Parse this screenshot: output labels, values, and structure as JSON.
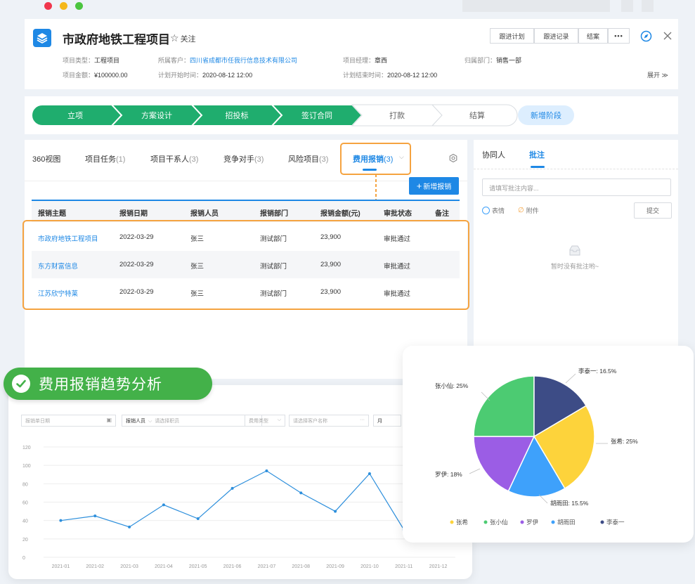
{
  "project": {
    "title": "市政府地铁工程项目",
    "follow": "关注",
    "buttons": [
      "跟进计划",
      "跟进记录",
      "结案"
    ],
    "more": "•••",
    "expand": "展开",
    "meta": {
      "type_label": "项目类型：",
      "type_value": "工程项目",
      "customer_label": "所属客户：",
      "customer_value": "四川省成都市任我行信息技术有限公司",
      "manager_label": "项目经理：",
      "manager_value": "章西",
      "dept_label": "归属部门：",
      "dept_value": "销售一部",
      "amount_label": "项目金额：",
      "amount_value": "¥100000.00",
      "start_label": "计划开始时间：",
      "start_value": "2020-08-12  12:00",
      "end_label": "计划结束时间：",
      "end_value": "2020-08-12  12:00"
    }
  },
  "stages": {
    "items": [
      "立项",
      "方案设计",
      "招投标",
      "签订合同",
      "打款",
      "结算"
    ],
    "completed": 4,
    "add": "新增阶段"
  },
  "tabs": [
    {
      "label": "360视图",
      "count": ""
    },
    {
      "label": "项目任务",
      "count": "(1)"
    },
    {
      "label": "项目干系人",
      "count": "(3)"
    },
    {
      "label": "竞争对手",
      "count": "(3)"
    },
    {
      "label": "风险项目",
      "count": "(3)"
    },
    {
      "label": "费用报销",
      "count": "(3)"
    }
  ],
  "table": {
    "add_button": "新增报销",
    "columns": [
      "报销主题",
      "报销日期",
      "报销人员",
      "报销部门",
      "报销金额(元)",
      "审批状态",
      "备注"
    ],
    "rows": [
      [
        "市政府地铁工程项目",
        "2022-03-29",
        "张三",
        "测试部门",
        "23,900",
        "审批通过",
        ""
      ],
      [
        "东方财富信息",
        "2022-03-29",
        "张三",
        "测试部门",
        "23,900",
        "审批通过",
        ""
      ],
      [
        "江苏欣宁特莱",
        "2022-03-29",
        "张三",
        "测试部门",
        "23,900",
        "审批通过",
        ""
      ]
    ]
  },
  "right_panel": {
    "tabs": [
      "协同人",
      "批注"
    ],
    "placeholder": "请填写批注内容...",
    "emoji": "表情",
    "attach": "附件",
    "submit": "提交",
    "empty": "暂时没有批注哟~"
  },
  "analysis": {
    "badge": "费用报销趋势分析",
    "filters": {
      "date_placeholder": "报销单日期",
      "person_label": "报销人员",
      "person_placeholder": "请选择职员",
      "type_placeholder": "费用类型",
      "customer_placeholder": "请选择客户名称",
      "period": "月"
    }
  },
  "colors": {
    "green": "#1fad6e",
    "blue": "#1e88e5",
    "orange": "#f5a340",
    "accent_badge": "#43b149"
  },
  "chart_data": [
    {
      "type": "line",
      "x": [
        "2021-01",
        "2021-02",
        "2021-03",
        "2021-04",
        "2021-05",
        "2021-06",
        "2021-07",
        "2021-08",
        "2021-09",
        "2021-10",
        "2021-11",
        "2021-12"
      ],
      "series": [
        {
          "values": [
            40,
            45,
            33,
            57,
            42,
            75,
            94,
            70,
            50,
            91,
            30,
            null
          ]
        }
      ],
      "yticks": [
        0,
        20,
        40,
        60,
        80,
        100,
        120
      ],
      "ylim": [
        0,
        120
      ],
      "grid": true
    },
    {
      "type": "pie",
      "slices": [
        {
          "name": "张希",
          "label": "张希: 25%",
          "value": 25,
          "color": "#fdd33b"
        },
        {
          "name": "张小仙",
          "label": "张小仙: 25%",
          "value": 25,
          "color": "#4ccb72"
        },
        {
          "name": "罗伊",
          "label": "罗伊: 18%",
          "value": 18,
          "color": "#9b5de5"
        },
        {
          "name": "胡雨田",
          "label": "胡雨田: 15.5%",
          "value": 15.5,
          "color": "#3ea1fb"
        },
        {
          "name": "李泰一",
          "label": "李泰一: 16.5%",
          "value": 16.5,
          "color": "#3d4c86"
        }
      ],
      "legend": "bottom"
    }
  ]
}
